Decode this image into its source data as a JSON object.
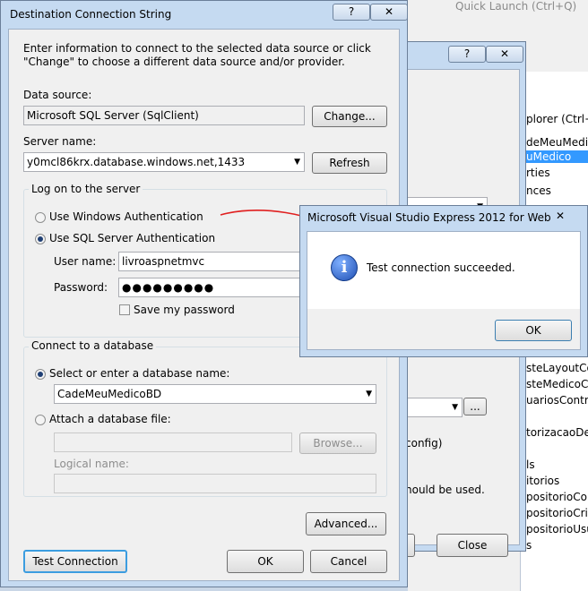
{
  "ide": {
    "quick_launch": "Quick Launch (Ctrl+Q)",
    "solution_items": [
      "deMeuMedico",
      "uMedico",
      "rties",
      "nces"
    ],
    "solution_items2": [
      "steLayoutCo",
      "steMedicoCo",
      "uariosContro",
      "torizacaoDeA",
      "ls",
      "itorios",
      "positorioCo",
      "positorioCrip",
      "positorioUsu",
      "s"
    ],
    "search_hint": "plorer (Ctrl+;"
  },
  "middle_dialog": {
    "help_glyph": "?",
    "close_glyph": "✕",
    "browse_label": "...",
    "partial_text1": "config)",
    "partial_text2": "hould be used.",
    "partial_button": "n",
    "close_label": "Close"
  },
  "dialog": {
    "title": "Destination Connection String",
    "help_glyph": "?",
    "close_glyph": "✕",
    "intro": "Enter information to connect to the selected data source or click \"Change\" to choose a different data source and/or provider.",
    "data_source_label": "Data source:",
    "data_source_value": "Microsoft SQL Server (SqlClient)",
    "change_label": "Change...",
    "server_name_label": "Server name:",
    "server_name_value": "y0mcl86krx.database.windows.net,1433",
    "refresh_label": "Refresh",
    "logon_group": "Log on to the server",
    "windows_auth": "Use Windows Authentication",
    "sql_auth": "Use SQL Server Authentication",
    "user_name_label": "User name:",
    "user_name_value": "livroaspnetmvc",
    "password_label": "Password:",
    "password_value": "●●●●●●●●●",
    "save_password": "Save my password",
    "connect_group": "Connect to a database",
    "select_db": "Select or enter a database name:",
    "db_value": "CadeMeuMedicoBD",
    "attach_db": "Attach a database file:",
    "browse_label": "Browse...",
    "logical_name": "Logical name:",
    "advanced_label": "Advanced...",
    "test_label": "Test Connection",
    "ok_label": "OK",
    "cancel_label": "Cancel"
  },
  "message_box": {
    "title": "Microsoft Visual Studio Express 2012 for Web",
    "close_glyph": "✕",
    "icon_glyph": "i",
    "message": "Test connection succeeded.",
    "ok_label": "OK"
  },
  "colors": {
    "accent": "#3399ff",
    "annotation": "#e02020"
  }
}
